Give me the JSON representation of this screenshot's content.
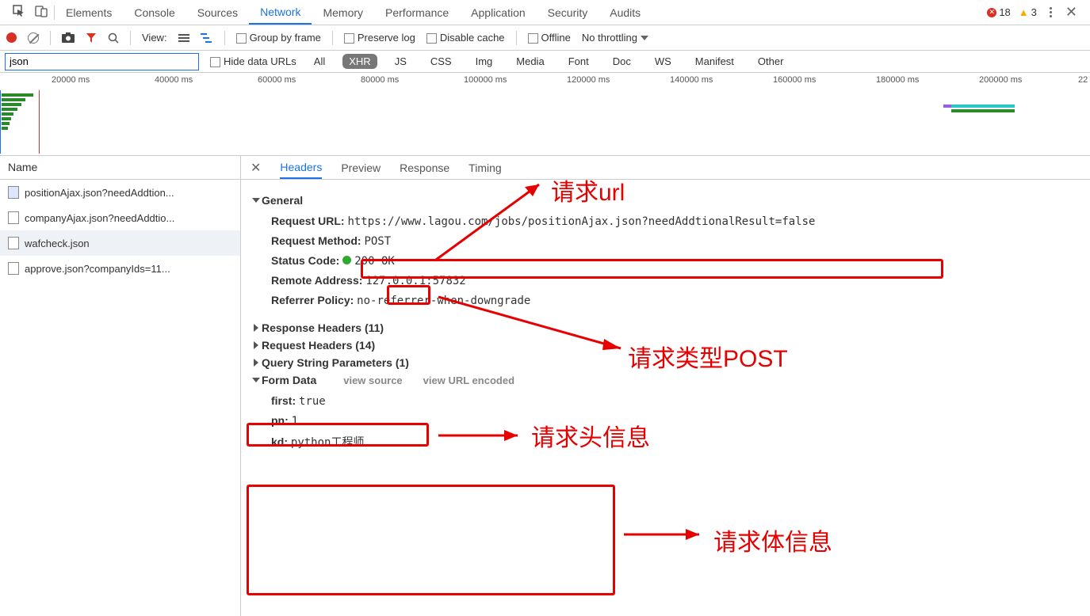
{
  "topTabs": {
    "items": [
      "Elements",
      "Console",
      "Sources",
      "Network",
      "Memory",
      "Performance",
      "Application",
      "Security",
      "Audits"
    ],
    "active": "Network",
    "errorCount": "18",
    "warnCount": "3"
  },
  "toolbar": {
    "viewLabel": "View:",
    "groupByFrame": "Group by frame",
    "preserveLog": "Preserve log",
    "disableCache": "Disable cache",
    "offline": "Offline",
    "throttling": "No throttling"
  },
  "filterBar": {
    "filterValue": "json",
    "hideDataUrls": "Hide data URLs",
    "types": [
      "All",
      "XHR",
      "JS",
      "CSS",
      "Img",
      "Media",
      "Font",
      "Doc",
      "WS",
      "Manifest",
      "Other"
    ],
    "activeType": "XHR"
  },
  "timeline": {
    "ticks": [
      "20000 ms",
      "40000 ms",
      "60000 ms",
      "80000 ms",
      "100000 ms",
      "120000 ms",
      "140000 ms",
      "160000 ms",
      "180000 ms",
      "200000 ms",
      "22"
    ]
  },
  "requestList": {
    "header": "Name",
    "items": [
      "positionAjax.json?needAddtion...",
      "companyAjax.json?needAddtio...",
      "wafcheck.json",
      "approve.json?companyIds=11..."
    ],
    "selectedIndex": 2
  },
  "detailTabs": {
    "items": [
      "Headers",
      "Preview",
      "Response",
      "Timing"
    ],
    "active": "Headers"
  },
  "general": {
    "title": "General",
    "requestUrlLabel": "Request URL:",
    "requestUrlValue": "https://www.lagou.com/jobs/positionAjax.json?needAddtionalResult=false",
    "requestMethodLabel": "Request Method:",
    "requestMethodValue": "POST",
    "statusCodeLabel": "Status Code:",
    "statusCodeValue": "200 OK",
    "remoteAddressLabel": "Remote Address:",
    "remoteAddressValue": "127.0.0.1:57832",
    "referrerPolicyLabel": "Referrer Policy:",
    "referrerPolicyValue": "no-referrer-when-downgrade"
  },
  "sections": {
    "responseHeaders": "Response Headers (11)",
    "requestHeaders": "Request Headers (14)",
    "queryString": "Query String Parameters (1)",
    "formData": "Form Data",
    "viewSource": "view source",
    "viewUrlEncoded": "view URL encoded"
  },
  "formData": {
    "first": {
      "k": "first:",
      "v": "true"
    },
    "pn": {
      "k": "pn:",
      "v": "1"
    },
    "kd": {
      "k": "kd:",
      "v": "python工程师"
    }
  },
  "annotations": {
    "reqUrl": "请求url",
    "reqType": "请求类型POST",
    "reqHeaders": "请求头信息",
    "reqBody": "请求体信息"
  }
}
